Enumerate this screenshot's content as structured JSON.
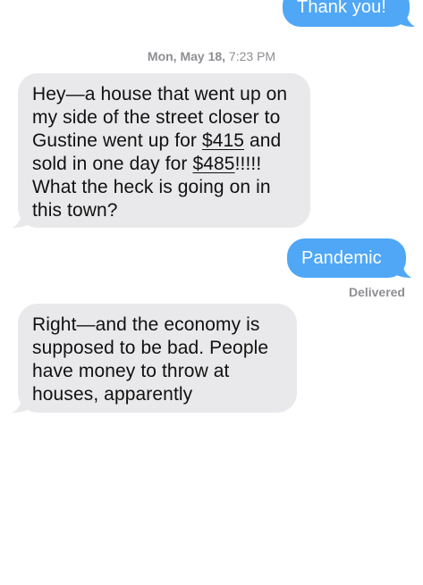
{
  "messages": [
    {
      "direction": "sent",
      "text": "Thank you!"
    },
    {
      "direction": "received",
      "lines": {
        "l1": "Hey—a house that went up on",
        "l2": "my side of the street closer to",
        "l3a": "Gustine went up for ",
        "l3b": "$415",
        "l3c": " and",
        "l4a": "sold in one day for ",
        "l4b": "$485",
        "l4c": "!!!!!",
        "l5": "What the heck is going on in",
        "l6": "this town?"
      }
    },
    {
      "direction": "sent",
      "text": "Pandemic"
    },
    {
      "direction": "received",
      "lines": {
        "l1": "Right—and the economy is",
        "l2": "supposed to be bad.  People",
        "l3": "have money to throw at",
        "l4": "houses, apparently"
      }
    }
  ],
  "timestamp": {
    "day": "Mon, May 18,",
    "time": " 7:23 PM"
  },
  "status": "Delivered",
  "colors": {
    "sent_bubble": "#4fa7f6",
    "received_bubble": "#e9e9eb",
    "meta_text": "#8e8e93"
  }
}
